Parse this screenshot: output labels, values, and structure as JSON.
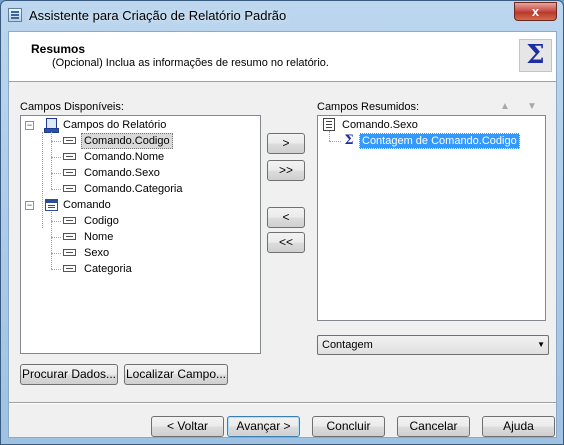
{
  "window": {
    "title": "Assistente para Criação de Relatório Padrão",
    "close_glyph": "x"
  },
  "header": {
    "title": "Resumos",
    "subtitle": "(Opcional) Inclua as informações de resumo no relatório.",
    "icon_glyph": "Σ"
  },
  "available": {
    "label": "Campos Disponíveis:",
    "tree": [
      {
        "label": "Campos do Relatório",
        "expander": "−"
      },
      {
        "label": "Comando.Codigo"
      },
      {
        "label": "Comando.Nome"
      },
      {
        "label": "Comando.Sexo"
      },
      {
        "label": "Comando.Categoria"
      },
      {
        "label": "Comando",
        "expander": "−"
      },
      {
        "label": "Codigo"
      },
      {
        "label": "Nome"
      },
      {
        "label": "Sexo"
      },
      {
        "label": "Categoria"
      }
    ]
  },
  "transfer": {
    "add": ">",
    "add_all": ">>",
    "remove": "<",
    "remove_all": "<<"
  },
  "summarized": {
    "label": "Campos Resumidos:",
    "up_glyph": "▲",
    "down_glyph": "▼",
    "tree": [
      {
        "label": "Comando.Sexo"
      },
      {
        "label": "Contagem de Comando.Codigo",
        "glyph": "Σ"
      }
    ]
  },
  "function_select": {
    "value": "Contagem",
    "chevron": "▼"
  },
  "buttons": {
    "browse": "Procurar Dados...",
    "find": "Localizar Campo...",
    "back": "< Voltar",
    "next": "Avançar >",
    "finish": "Concluir",
    "cancel": "Cancelar",
    "help": "Ajuda"
  }
}
